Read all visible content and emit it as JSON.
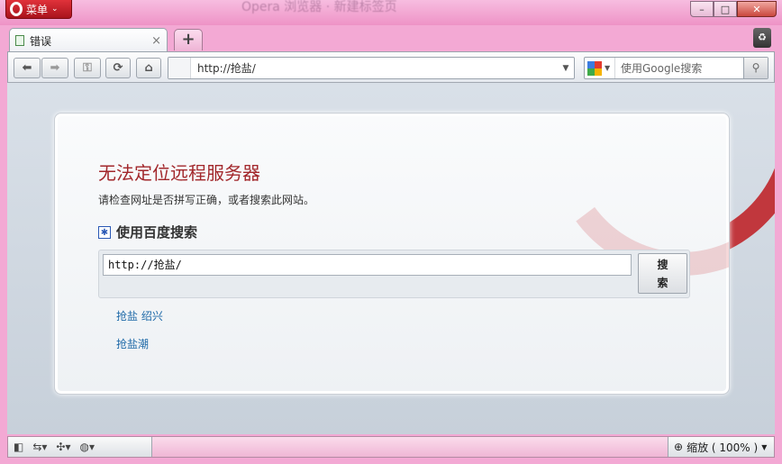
{
  "window": {
    "menu_label": "菜单",
    "ghost_title": "Opera 浏览器 · 新建标签页",
    "ghost_sub": "",
    "controls": {
      "minimize": "–",
      "maximize": "□",
      "close": "✕"
    }
  },
  "tabs": [
    {
      "label": "错误",
      "close": "×"
    }
  ],
  "new_tab_label": "+",
  "toolbar": {
    "address_value": "http://抢盐/",
    "search_placeholder": "使用Google搜索"
  },
  "page": {
    "title": "无法定位远程服务器",
    "subtitle": "请检查网址是否拼写正确，或者搜索此网站。",
    "search_heading": "使用百度搜索",
    "search_input_value": "http://抢盐/",
    "search_button": "搜\n索",
    "suggestions": [
      "抢盐 绍兴",
      "抢盐潮"
    ]
  },
  "status": {
    "zoom_label": "缩放 ( 100% )"
  },
  "colors": {
    "accent_red": "#a2272b",
    "link_blue": "#1f6aa8",
    "frame_pink": "#f3a9d4"
  }
}
